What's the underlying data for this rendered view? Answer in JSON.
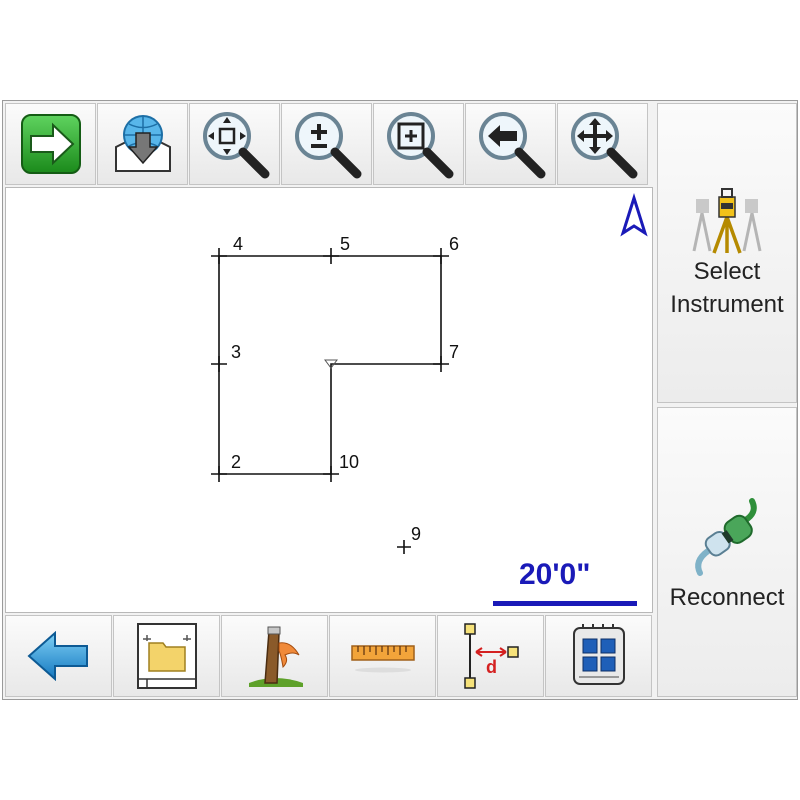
{
  "toolbar_top": [
    {
      "name": "continue-button",
      "icon": "green-arrow-right-icon"
    },
    {
      "name": "import-button",
      "icon": "globe-download-icon"
    },
    {
      "name": "zoom-extents-button",
      "icon": "zoom-extents-icon"
    },
    {
      "name": "zoom-in-out-button",
      "icon": "zoom-plus-minus-icon"
    },
    {
      "name": "zoom-window-button",
      "icon": "zoom-window-icon"
    },
    {
      "name": "zoom-previous-button",
      "icon": "zoom-previous-icon"
    },
    {
      "name": "pan-button",
      "icon": "pan-icon"
    }
  ],
  "toolbar_bottom": [
    {
      "name": "back-button",
      "icon": "blue-arrow-left-icon"
    },
    {
      "name": "layers-button",
      "icon": "folder-frame-icon"
    },
    {
      "name": "stakeout-button",
      "icon": "stake-flag-icon"
    },
    {
      "name": "measure-button",
      "icon": "ruler-icon"
    },
    {
      "name": "offset-button",
      "icon": "offset-distance-icon"
    },
    {
      "name": "grid-button",
      "icon": "grid-calculator-icon"
    }
  ],
  "side": {
    "select_instrument": "Select\nInstrument",
    "reconnect": "Reconnect"
  },
  "map": {
    "points": [
      {
        "id": "2",
        "label": "2"
      },
      {
        "id": "3",
        "label": "3"
      },
      {
        "id": "4",
        "label": "4"
      },
      {
        "id": "5",
        "label": "5"
      },
      {
        "id": "6",
        "label": "6"
      },
      {
        "id": "7",
        "label": "7"
      },
      {
        "id": "10",
        "label": "10"
      },
      {
        "id": "9",
        "label": "9"
      }
    ],
    "scale_label": "20'0\"",
    "north_icon": "north-arrow-icon"
  },
  "colors": {
    "scale": "#1a1ab8",
    "north": "#1a1ab8",
    "lines": "#111111"
  }
}
